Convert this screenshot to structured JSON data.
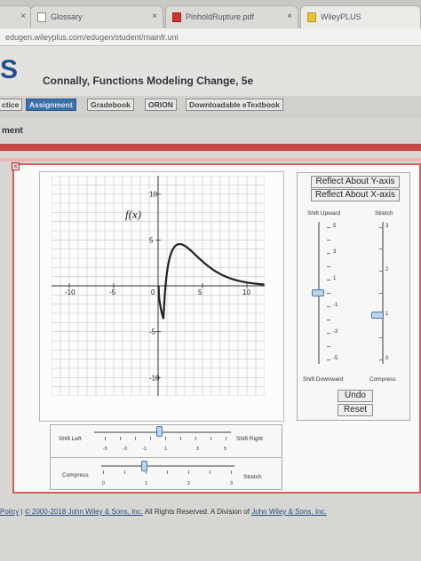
{
  "browser": {
    "tabs": [
      {
        "label": "Glossary",
        "close": "×"
      },
      {
        "label": "PinholdRupture.pdf",
        "close": "×"
      },
      {
        "label": "WileyPLUS",
        "close": ""
      }
    ],
    "first_tab_close": "×",
    "address": "edugen.wileyplus.com/edugen/student/mainfr.uni"
  },
  "site": {
    "brand": "S",
    "book_title": "Connally, Functions Modeling Change, 5e",
    "nav": [
      "ctice",
      "Assignment",
      "Gradebook",
      "ORION",
      "Downloadable eTextbook"
    ],
    "section": "ment",
    "close_label": "×"
  },
  "applet": {
    "function_label": "f(x)",
    "x_ticks": [
      "-10",
      "-5",
      "0",
      "5",
      "10"
    ],
    "y_ticks": [
      "10",
      "5",
      "-5",
      "-10"
    ],
    "reflect_y": "Reflect About Y-axis",
    "reflect_x": "Reflect About X-axis",
    "shift_upward": "Shift Upward",
    "shift_downward": "Shift Downward",
    "stretch_top": "Stretch",
    "compress_bottom": "Compress",
    "shift_ticks": [
      "5",
      "3",
      "1",
      "-1",
      "-3",
      "-5"
    ],
    "stretch_ticks": [
      "3",
      "2",
      "1",
      "0"
    ],
    "undo": "Undo",
    "reset": "Reset",
    "shift_left": "Shift Left",
    "shift_right": "Shift Right",
    "hshift_ticks": [
      "-5",
      "-3",
      "-1",
      "1",
      "3",
      "5"
    ],
    "compress": "Compress",
    "stretch": "Stretch",
    "hstretch_ticks": [
      "0",
      "1",
      "2",
      "3"
    ]
  },
  "footer": {
    "policy": "Policy",
    "separator": "|",
    "copyright": "© 2000-2018 John Wiley & Sons, Inc.",
    "rights": "All Rights Reserved. A Division of",
    "company": "John Wiley & Sons, Inc."
  },
  "colors": {
    "brand": "#1f4f8a",
    "accent_red": "#c64a4a",
    "curve": "#222222"
  }
}
